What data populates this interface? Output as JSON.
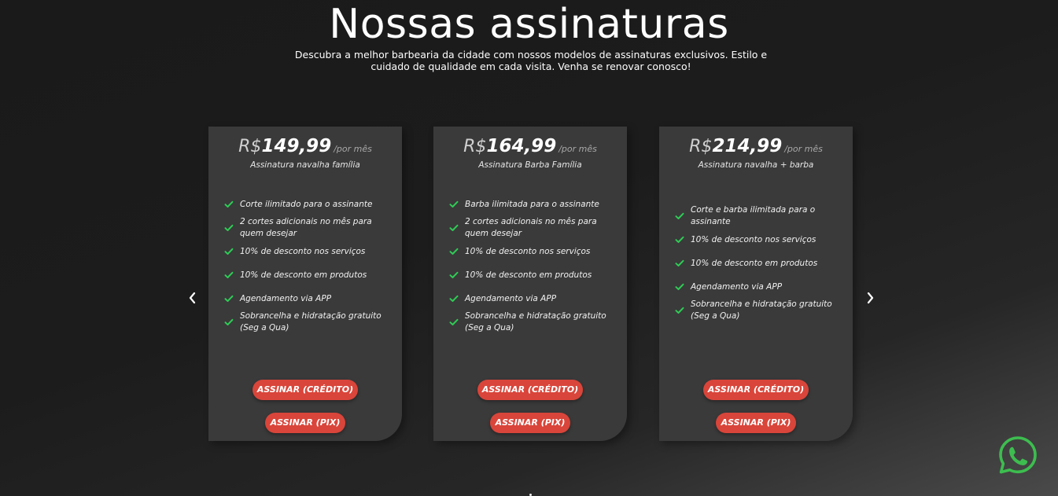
{
  "header": {
    "title": "Nossas assinaturas",
    "subtitle": "Descubra a melhor barbearia da cidade com nossos modelos de assinaturas exclusivos. Estilo e cuidado de qualidade em cada visita. Venha se renovar conosco!"
  },
  "carousel": {
    "prev_icon": "chevron-left-icon",
    "next_icon": "chevron-right-icon"
  },
  "plans": [
    {
      "currency": "R$",
      "price": "149,99",
      "period": "/por mês",
      "name": "Assinatura navalha família",
      "features": [
        "Corte ilimitado para o assinante",
        "2 cortes adicionais no mês para quem desejar",
        "10% de desconto nos serviços",
        "10% de desconto em produtos",
        "Agendamento via APP",
        "Sobrancelha e hidratação gratuito (Seg a Qua)"
      ],
      "button_credit": "ASSINAR (CRÉDITO)",
      "button_pix": "ASSINAR (PIX)"
    },
    {
      "currency": "R$",
      "price": "164,99",
      "period": "/por mês",
      "name": "Assinatura Barba Família",
      "features": [
        "Barba ilimitada para o assinante",
        "2 cortes adicionais no mês para quem desejar",
        "10% de desconto nos serviços",
        "10% de desconto em produtos",
        "Agendamento via APP",
        "Sobrancelha e hidratação gratuito (Seg a Qua)"
      ],
      "button_credit": "ASSINAR (CRÉDITO)",
      "button_pix": "ASSINAR (PIX)"
    },
    {
      "currency": "R$",
      "price": "214,99",
      "period": "/por mês",
      "name": "Assinatura navalha + barba",
      "features": [
        "Corte e barba ilimitada para o assinante",
        "10% de desconto nos serviços",
        "10% de desconto em produtos",
        "Agendamento via APP",
        "Sobrancelha e hidratação gratuito (Seg a Qua)"
      ],
      "button_credit": "ASSINAR (CRÉDITO)",
      "button_pix": "ASSINAR (PIX)"
    }
  ],
  "colors": {
    "accent": "#d9453a",
    "check": "#2ecc55",
    "card": "#3a3a3a",
    "whatsapp": "#3dbd4f"
  },
  "floating": {
    "whatsapp_icon": "whatsapp-icon"
  }
}
